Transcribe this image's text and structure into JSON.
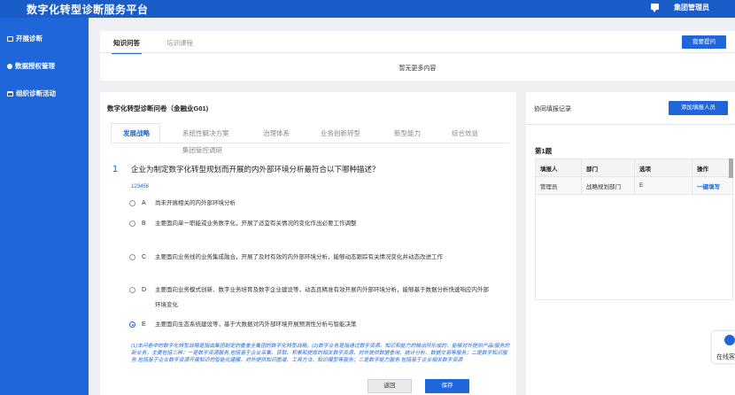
{
  "header": {
    "title": "数字化转型诊断服务平台",
    "user": "集团管理员"
  },
  "sidebar": {
    "items": [
      {
        "label": "开展诊断",
        "icon": "monitor-icon"
      },
      {
        "label": "数据授权管理",
        "icon": "pie-chart-icon"
      },
      {
        "label": "组织诊断活动",
        "icon": "calendar-icon"
      }
    ]
  },
  "top_card": {
    "tabs": [
      "知识问答",
      "培训课程"
    ],
    "ask_button": "我要提问",
    "empty_text": "暂无更多内容"
  },
  "questionnaire": {
    "title": "数字化转型诊断问卷（金融业G01)",
    "tabs": [
      "发展战略",
      "系统性解决方案",
      "治理体系",
      "业务创新转型",
      "新型能力",
      "综合效益",
      "集团管控调研"
    ],
    "question": {
      "number": "1",
      "text": "企业为制定数字化转型规划而开展的内外部环境分析最符合以下哪种描述？",
      "code": "123456",
      "options": [
        {
          "letter": "A",
          "text": "尚未开展相关的内外部环境分析",
          "selected": false
        },
        {
          "letter": "B",
          "text": "主要面向单一职能或业务数字化，开展了适宜有关情况的变化作出必要工作调整",
          "selected": false
        },
        {
          "letter": "C",
          "text": "主要面向业务线的业务集成融合，开展了及时有效的内外部环境分析，能够动态跟踪有关情况变化并动态改进工作",
          "selected": false
        },
        {
          "letter": "D",
          "text": "主要面向业务模式创新、数字业务培育及数字企业建设等，动态且精准有效开展内外部环境分析，能够基于数据分析快速响应内外部环境变化",
          "selected": false
        },
        {
          "letter": "E",
          "text": "主要面向生态系统建设等，基于大数据对内外部环境开展预测性分析与智能决策",
          "selected": true
        }
      ],
      "note": "(1)本问卷中的数字化转型战略是指由集团制定的覆盖全集团的数字化转型战略。(2)数字业务是指通过数字资源、知识和能力的输出所形成的，能够对外提供产品/服务的新业务，主要包括三种：一是数字资源服务,包括基于企业采集、获取、积累和提炼的相关数字资源，对外提供数据查询、统计分析、数据交易等服务；二是数字知识服务,包括基于企业数字资源开展知识的智能化建模，对外提供知识图谱、工具方法、知识模型等服务；三是数字能力服务,包括基于企业相关数字资源"
    }
  },
  "collab": {
    "title": "协同填报记录",
    "add_button": "添加填报人员",
    "subtitle": "第1题",
    "columns": [
      "填报人",
      "部门",
      "选项",
      "操作"
    ],
    "rows": [
      {
        "person": "管理员",
        "dept": "战略规划部门",
        "option": "E",
        "action": "一键填写"
      }
    ]
  },
  "float_service": {
    "label": "在线客服"
  },
  "footer": {
    "back": "返回",
    "save": "保存"
  },
  "colors": {
    "primary": "#1e66d9",
    "header": "#1a5cc8",
    "background": "#eef0f3"
  }
}
